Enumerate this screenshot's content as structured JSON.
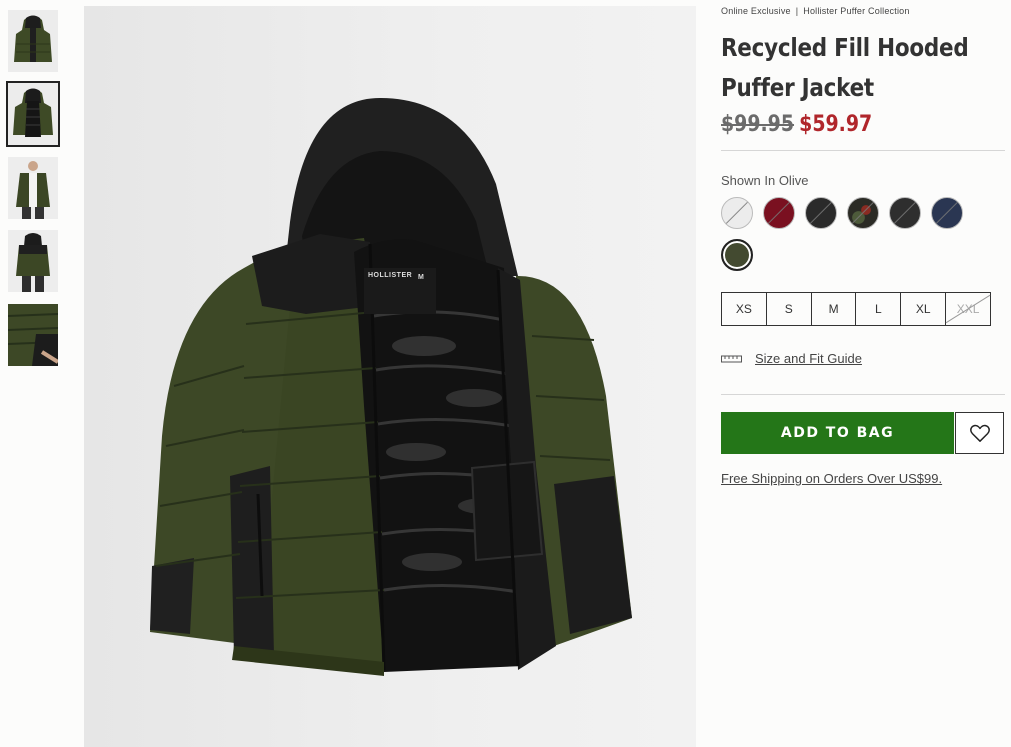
{
  "product": {
    "eyebrow_tag": "Online Exclusive",
    "eyebrow_separator": "|",
    "collection": "Hollister Puffer Collection",
    "title": "Recycled Fill Hooded Puffer Jacket",
    "original_price": "$99.95",
    "sale_price": "$59.97",
    "shown_in": "Shown In Olive"
  },
  "gallery": {
    "thumbnails": [
      {
        "name": "front-closed",
        "selected": false
      },
      {
        "name": "front-open",
        "selected": true
      },
      {
        "name": "model-front",
        "selected": false
      },
      {
        "name": "model-back",
        "selected": false
      },
      {
        "name": "sleeve-detail",
        "selected": false
      }
    ],
    "main_image_label_brand": "HOLLISTER",
    "main_image_label_size": "M"
  },
  "swatches": [
    {
      "color": "#e8e8e8",
      "name": "white",
      "selected": false
    },
    {
      "color": "#7a1020",
      "name": "burgundy",
      "selected": false
    },
    {
      "color": "#2a2a2a",
      "name": "black",
      "selected": false
    },
    {
      "color": "#3c3f33",
      "name": "camo",
      "selected": false
    },
    {
      "color": "#2e2e2e",
      "name": "black-2",
      "selected": false
    },
    {
      "color": "#2a3652",
      "name": "navy",
      "selected": false
    },
    {
      "color": "#434a30",
      "name": "olive",
      "selected": true
    }
  ],
  "sizes": [
    {
      "label": "XS",
      "available": true
    },
    {
      "label": "S",
      "available": true
    },
    {
      "label": "M",
      "available": true
    },
    {
      "label": "L",
      "available": true
    },
    {
      "label": "XL",
      "available": true
    },
    {
      "label": "XXL",
      "available": false
    }
  ],
  "fit_guide_label": "Size and Fit Guide",
  "add_to_bag_label": "ADD TO BAG",
  "shipping_text": "Free Shipping on Orders Over US$99.",
  "colors": {
    "accent_green": "#247618",
    "sale_red": "#b0262b",
    "olive": "#3f4a25"
  }
}
